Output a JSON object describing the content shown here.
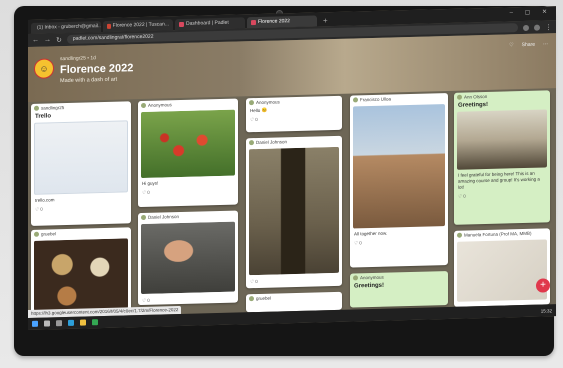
{
  "browser": {
    "tabs": [
      {
        "label": "(1) Inbox - gruberch@gmail...",
        "active": false
      },
      {
        "label": "Florence 2022 | Tuscan...",
        "active": false
      },
      {
        "label": "Dashboard | Padlet",
        "active": false
      },
      {
        "label": "Florence 2022",
        "active": true
      }
    ],
    "url": "padlet.com/sandlingrat/florence2022"
  },
  "padlet": {
    "author": "sandlingr25 • 1d",
    "title": "Florence 2022",
    "subtitle": "Made with a dash of art",
    "header_actions": [
      "♡",
      "Share",
      "⋯"
    ]
  },
  "cards": [
    {
      "id": "c1",
      "author": "sandlingr25",
      "title": "Trello",
      "text": "trello.com",
      "likes": "♡ 0"
    },
    {
      "id": "c2",
      "author": "Anonymous",
      "title": "",
      "text": "Hi guys!",
      "likes": "♡ 0"
    },
    {
      "id": "c3",
      "author": "Anonymous",
      "title": "",
      "text": "Hello 😊",
      "likes": "♡ 0"
    },
    {
      "id": "c4",
      "author": "Daniel Johnson",
      "title": "",
      "text": "",
      "likes": "♡ 0"
    },
    {
      "id": "c5",
      "author": "Francisco Ulloa",
      "title": "",
      "text": "All together now.",
      "likes": "♡ 0"
    },
    {
      "id": "c6",
      "author": "Ann Olsson",
      "title": "Greetings!",
      "text": "I feel grateful for being here! This is an amazing course and group! It's working a lot!",
      "likes": "♡ 0"
    },
    {
      "id": "c7",
      "author": "gruebel",
      "title": "",
      "text": "",
      "likes": ""
    },
    {
      "id": "c8",
      "author": "Daniel Johnson",
      "title": "",
      "text": "",
      "likes": "♡ 0"
    },
    {
      "id": "c9",
      "author": "Anonymous",
      "title": "Greetings!",
      "text": "",
      "likes": ""
    },
    {
      "id": "c10",
      "author": "Manuela Fortuna (Prof MA, MMB)",
      "title": "",
      "text": "",
      "likes": ""
    }
  ],
  "status_url": "https://lh3.googleusercontent.com/2016/f/05/4/c0ec/1.7/2m/Florence-2022",
  "taskbar": {
    "time": "15:32"
  },
  "fab_label": "+"
}
